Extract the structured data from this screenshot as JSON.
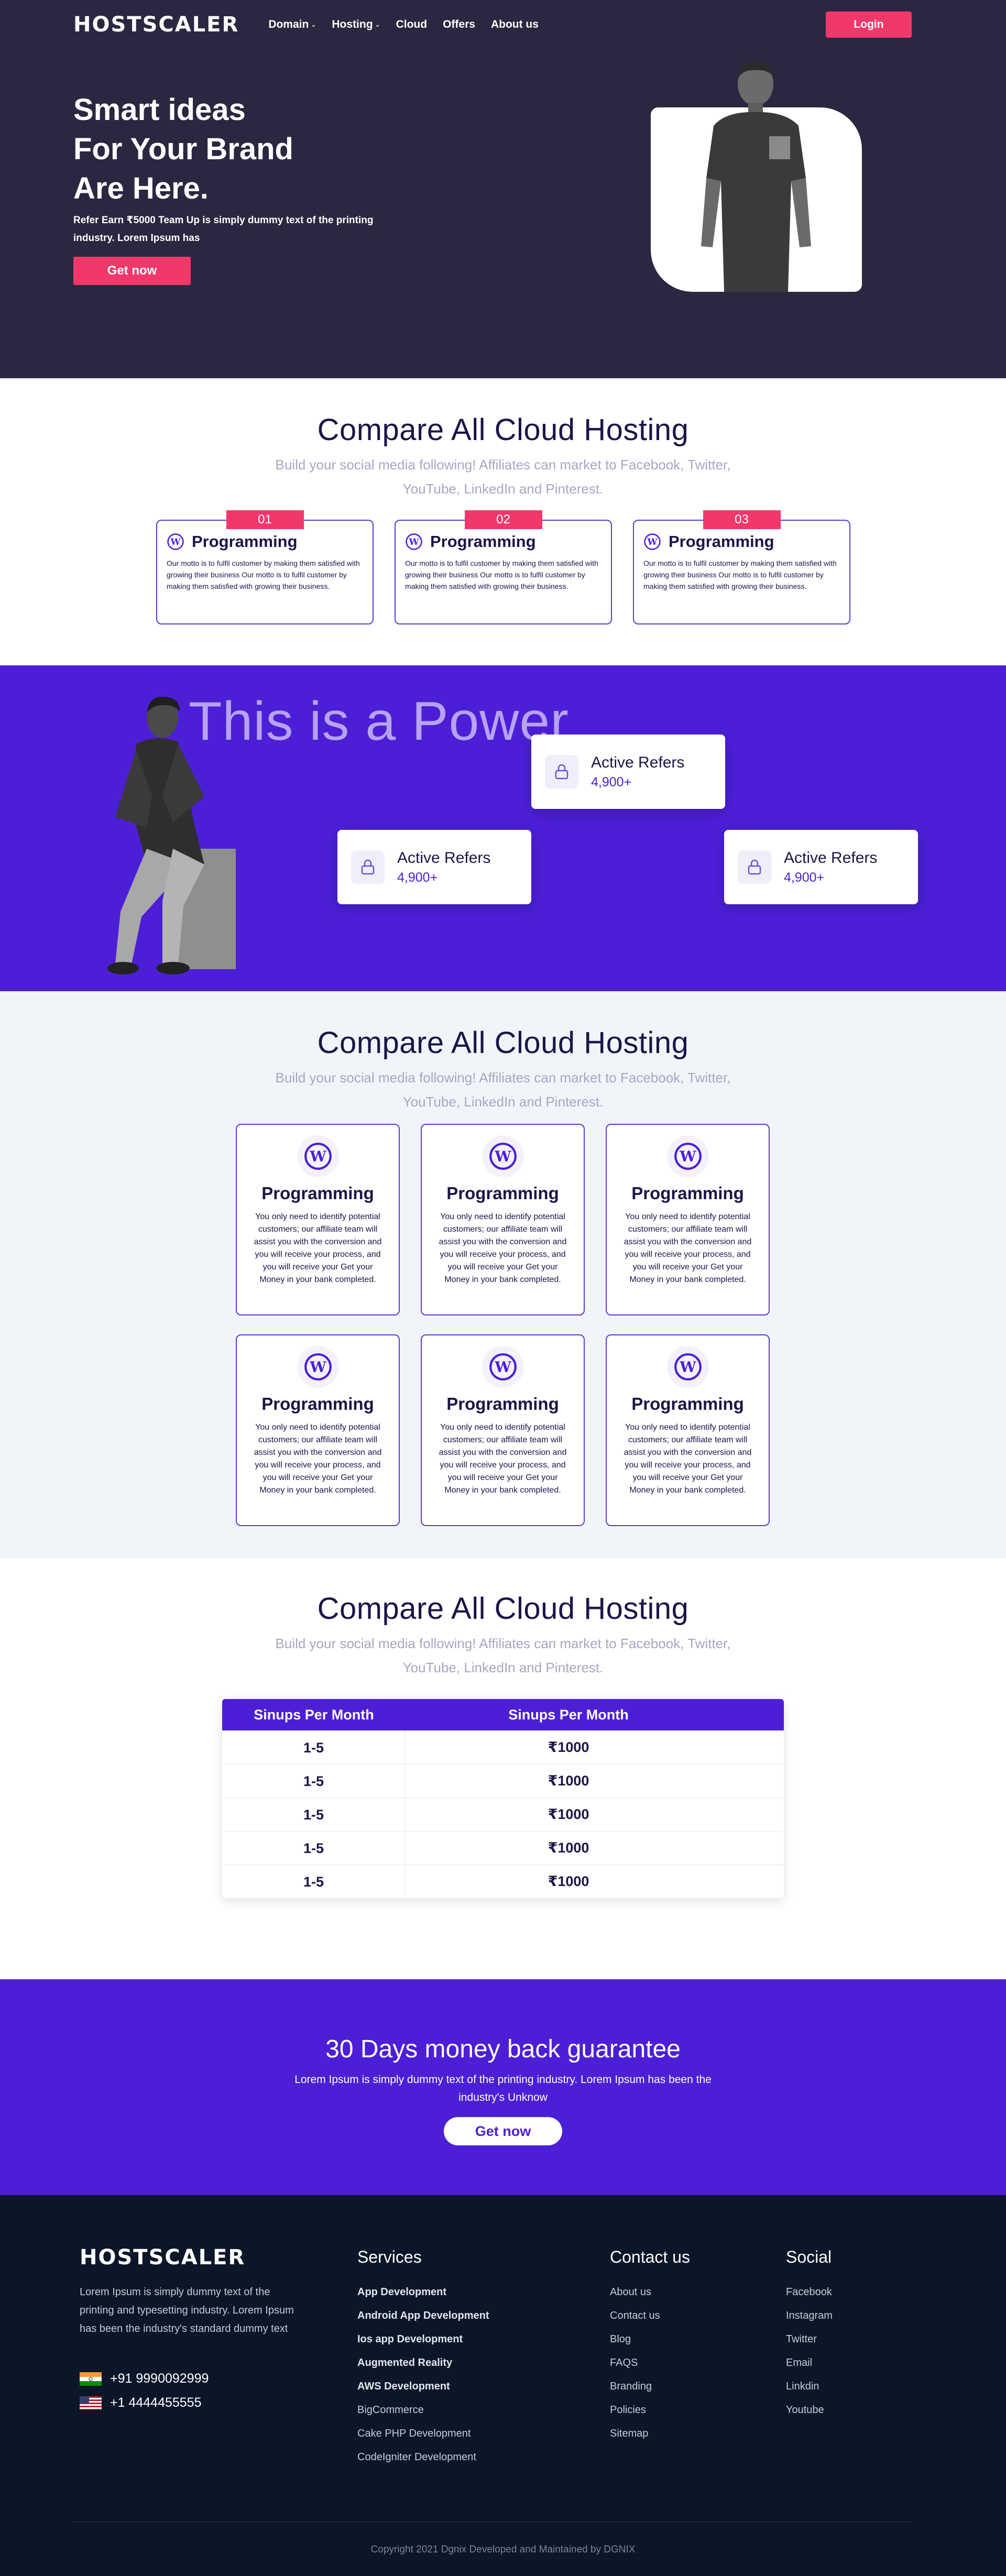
{
  "brand": {
    "logo": "HOSTSCALER",
    "accent": "#f2386b",
    "purple": "#4c1fd6",
    "dark": "#2d2640"
  },
  "nav": {
    "items": [
      {
        "label": "Domain",
        "dropdown": true
      },
      {
        "label": "Hosting",
        "dropdown": true
      },
      {
        "label": "Cloud",
        "dropdown": false
      },
      {
        "label": "Offers",
        "dropdown": false
      },
      {
        "label": "About us",
        "dropdown": false
      }
    ],
    "login": "Login"
  },
  "hero": {
    "title_line1": "Smart ideas",
    "title_line2": "For Your Brand",
    "title_line3": "Are Here.",
    "text": "Refer Earn ₹5000 Team Up is simply dummy text of the printing industry. Lorem Ipsum has",
    "cta": "Get now"
  },
  "compare1": {
    "title": "Compare All Cloud Hosting",
    "subtitle": "Build your social media following! Affiliates can market to Facebook, Twitter, YouTube, LinkedIn and Pinterest.",
    "cards": [
      {
        "num": "01",
        "title": "Programming",
        "text": "Our motto is to fulfil customer by making them satisfied with growing their business Our motto is to fulfil customer by making them satisfied with growing their business."
      },
      {
        "num": "02",
        "title": "Programming",
        "text": "Our motto is to fulfil customer by making them satisfied with growing their business Our motto is to fulfil customer by making them satisfied with growing their business."
      },
      {
        "num": "03",
        "title": "Programming",
        "text": "Our motto is to fulfil customer by making them satisfied with growing their business Our motto is to fulfil customer by making them satisfied with growing their business."
      }
    ]
  },
  "power": {
    "headline": "This is a Power",
    "refers": [
      {
        "label": "Active Refers",
        "value": "4,900+"
      },
      {
        "label": "Active Refers",
        "value": "4,900+"
      },
      {
        "label": "Active Refers",
        "value": "4,900+"
      }
    ]
  },
  "compare2": {
    "title": "Compare All Cloud Hosting",
    "subtitle": "Build your social media following! Affiliates can market to Facebook, Twitter, YouTube, LinkedIn and Pinterest.",
    "cards": [
      {
        "title": "Programming",
        "text": "You only need to identify potential customers; our affiliate team will assist you with the conversion and you will receive your process, and you will receive your Get your Money in your bank completed."
      },
      {
        "title": "Programming",
        "text": "You only need to identify potential customers; our affiliate team will assist you with the conversion and you will receive your process, and you will receive your Get your Money in your bank completed."
      },
      {
        "title": "Programming",
        "text": "You only need to identify potential customers; our affiliate team will assist you with the conversion and you will receive your process, and you will receive your Get your Money in your bank completed."
      },
      {
        "title": "Programming",
        "text": "You only need to identify potential customers; our affiliate team will assist you with the conversion and you will receive your process, and you will receive your Get your Money in your bank completed."
      },
      {
        "title": "Programming",
        "text": "You only need to identify potential customers; our affiliate team will assist you with the conversion and you will receive your process, and you will receive your Get your Money in your bank completed."
      },
      {
        "title": "Programming",
        "text": "You only need to identify potential customers; our affiliate team will assist you with the conversion and you will receive your process, and you will receive your Get your Money in your bank completed."
      }
    ]
  },
  "compare3": {
    "title": "Compare All Cloud Hosting",
    "subtitle": "Build your social media following! Affiliates can market to Facebook, Twitter, YouTube, LinkedIn and Pinterest.",
    "table": {
      "headers": [
        "Sinups Per Month",
        "Sinups Per Month"
      ],
      "rows": [
        [
          "1-5",
          "₹1000"
        ],
        [
          "1-5",
          "₹1000"
        ],
        [
          "1-5",
          "₹1000"
        ],
        [
          "1-5",
          "₹1000"
        ],
        [
          "1-5",
          "₹1000"
        ]
      ]
    }
  },
  "guarantee": {
    "title": "30 Days money back guarantee",
    "text": "Lorem Ipsum is simply dummy text of the printing industry. Lorem Ipsum has been the industry's Unknow",
    "cta": "Get now"
  },
  "footer": {
    "logo": "HOSTSCALER",
    "about": "Lorem Ipsum is simply dummy text of the printing and typesetting industry. Lorem Ipsum has been the industry's standard dummy text",
    "phones": [
      {
        "flag": "india-flag-icon",
        "number": "+91 9990092999"
      },
      {
        "flag": "usa-flag-icon",
        "number": "+1 4444455555"
      }
    ],
    "services": {
      "title": "Services",
      "items": [
        "App Development",
        "Android App Development",
        "Ios app Development",
        "Augmented Reality",
        "AWS Development",
        "BigCommerce",
        "Cake PHP Development",
        "CodeIgniter Development"
      ]
    },
    "contact": {
      "title": "Contact us",
      "items": [
        "About us",
        "Contact us",
        "Blog",
        "FAQS",
        "Branding",
        "Policies",
        "Sitemap"
      ]
    },
    "social": {
      "title": "Social",
      "items": [
        "Facebook",
        "Instagram",
        "Twitter",
        "Email",
        "Linkdin",
        "Youtube"
      ]
    },
    "copyright": "Copyright 2021 Dgnix Developed and Maintained by DGNIX"
  }
}
